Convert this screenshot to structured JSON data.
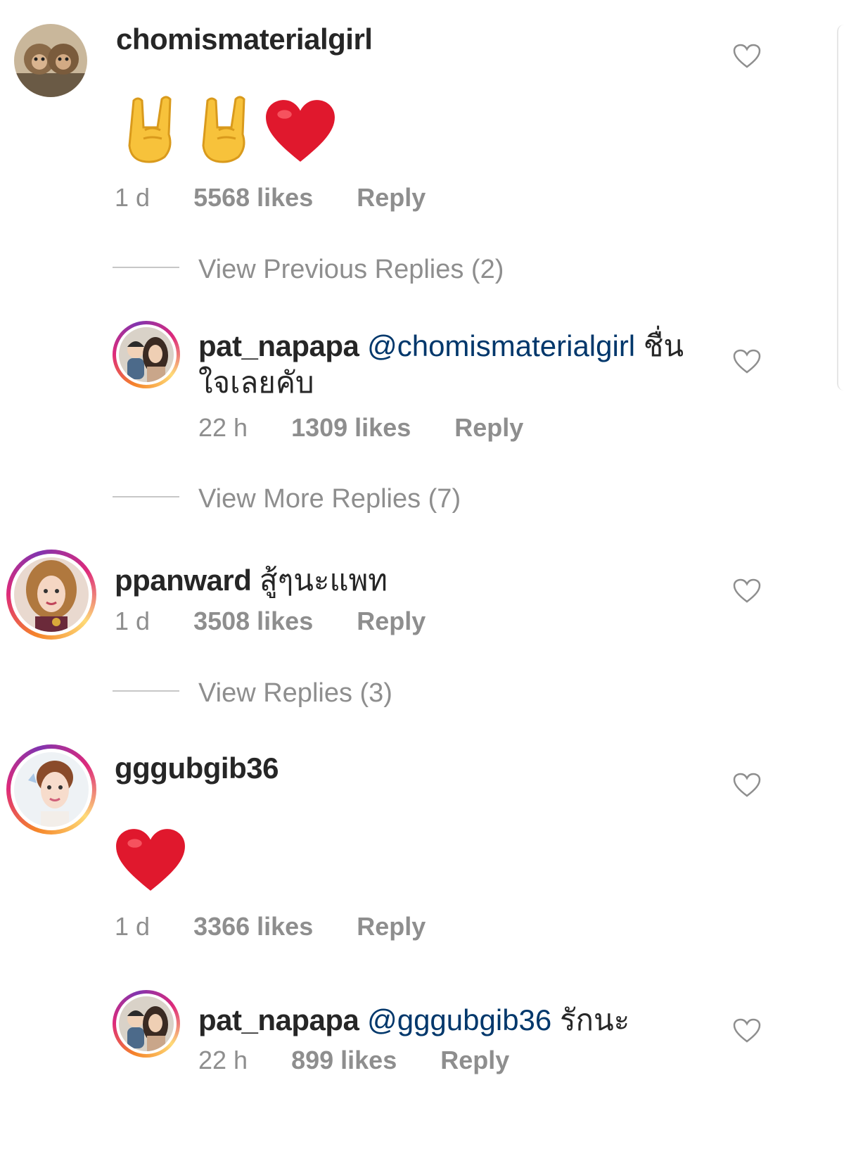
{
  "comments": [
    {
      "username": "chomismaterialgirl",
      "text": "",
      "emojis": [
        "horns-hand",
        "horns-hand",
        "red-heart"
      ],
      "time": "1 d",
      "likes": "5568 likes",
      "reply_label": "Reply"
    },
    {
      "username": "ppanward",
      "text": "สู้ๆนะแพท",
      "time": "1 d",
      "likes": "3508 likes",
      "reply_label": "Reply"
    },
    {
      "username": "gggubgib36",
      "text": "",
      "emojis": [
        "red-heart"
      ],
      "time": "1 d",
      "likes": "3366 likes",
      "reply_label": "Reply"
    }
  ],
  "replies": [
    {
      "username": "pat_napapa",
      "mention": "@chomismaterialgirl",
      "text_line1": "ชื่น",
      "text_line2": "ใจเลยคับ",
      "time": "22 h",
      "likes": "1309 likes",
      "reply_label": "Reply"
    },
    {
      "username": "pat_napapa",
      "mention": "@gggubgib36",
      "text_line1": "รักนะ",
      "time": "22 h",
      "likes": "899 likes",
      "reply_label": "Reply"
    }
  ],
  "view_links": {
    "previous": "View Previous Replies (2)",
    "more": "View More Replies (7)",
    "replies": "View Replies (3)"
  },
  "colors": {
    "username": "#262626",
    "mention": "#00376b",
    "meta": "#8e8e8e",
    "heart": "#e0182d",
    "story_ring": "#dd2a7b"
  }
}
